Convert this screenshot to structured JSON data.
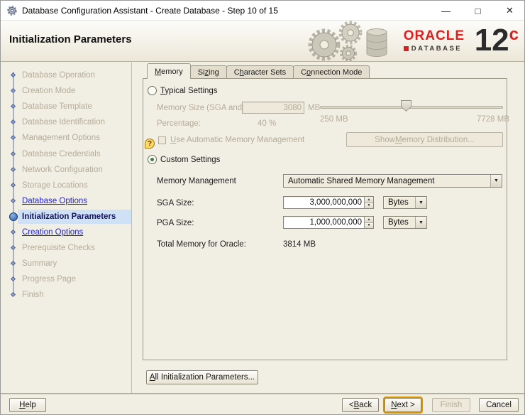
{
  "window": {
    "title": "Database Configuration Assistant - Create Database - Step 10 of 15",
    "minimize_glyph": "—",
    "maximize_glyph": "□",
    "close_glyph": "✕"
  },
  "header": {
    "page_title": "Initialization Parameters",
    "brand": {
      "oracle": "ORACLE",
      "database": "DATABASE",
      "version_number": "12",
      "version_letter": "c"
    }
  },
  "colors": {
    "oracle_red": "#e21d1d",
    "link_blue": "#2424cc",
    "current_step_highlight": "#cfe1f4",
    "default_button_focus_orange": "#d89400"
  },
  "sidebar": {
    "steps": [
      {
        "label": "Database Operation",
        "state": "inactive"
      },
      {
        "label": "Creation Mode",
        "state": "inactive"
      },
      {
        "label": "Database Template",
        "state": "inactive"
      },
      {
        "label": "Database Identification",
        "state": "inactive"
      },
      {
        "label": "Management Options",
        "state": "inactive"
      },
      {
        "label": "Database Credentials",
        "state": "inactive"
      },
      {
        "label": "Network Configuration",
        "state": "inactive"
      },
      {
        "label": "Storage Locations",
        "state": "inactive"
      },
      {
        "label": "Database Options",
        "state": "link"
      },
      {
        "label": "Initialization Parameters",
        "state": "current"
      },
      {
        "label": "Creation Options",
        "state": "link"
      },
      {
        "label": "Prerequisite Checks",
        "state": "inactive"
      },
      {
        "label": "Summary",
        "state": "inactive"
      },
      {
        "label": "Progress Page",
        "state": "inactive"
      },
      {
        "label": "Finish",
        "state": "inactive"
      }
    ]
  },
  "tabs": [
    {
      "label": "Memory",
      "m": 0,
      "active": true
    },
    {
      "label": "Sizing",
      "m": 2,
      "active": false
    },
    {
      "label": "Character Sets",
      "m": 1,
      "active": false
    },
    {
      "label": "Connection Mode",
      "m": 1,
      "active": false
    }
  ],
  "memory_tab": {
    "typical": {
      "radio": {
        "label": "Typical Settings",
        "m": 0,
        "selected": false
      },
      "memory_size_label": "Memory Size (SGA and PGA):",
      "memory_size_value": "3080",
      "memory_size_unit": "MB",
      "percentage_label": "Percentage:",
      "percentage_value": "40 %",
      "slider": {
        "min_label": "250 MB",
        "max_label": "7728 MB"
      },
      "amm_checkbox": {
        "label": "Use Automatic Memory Management",
        "m": 0,
        "checked": false
      },
      "show_distribution_button": {
        "label": "Show Memory Distribution...",
        "m": 5,
        "enabled": false
      }
    },
    "custom": {
      "radio": {
        "label": "Custom Settings",
        "selected": true
      },
      "memory_management_label": "Memory Management",
      "memory_management_value": "Automatic Shared Memory Management",
      "sga_label": "SGA Size:",
      "sga_value": "3,000,000,000",
      "sga_unit": "Bytes",
      "pga_label": "PGA Size:",
      "pga_value": "1,000,000,000",
      "pga_unit": "Bytes",
      "total_label": "Total Memory for Oracle:",
      "total_value": "3814 MB"
    },
    "all_params_button": {
      "label": "All Initialization Parameters...",
      "m": 0
    }
  },
  "footer": {
    "help": {
      "label": "Help",
      "m": 0
    },
    "back": {
      "label": "< Back",
      "m": 2
    },
    "next": {
      "label": "Next >",
      "m": 0,
      "default": true
    },
    "finish": {
      "label": "Finish",
      "enabled": false
    },
    "cancel": {
      "label": "Cancel"
    }
  }
}
